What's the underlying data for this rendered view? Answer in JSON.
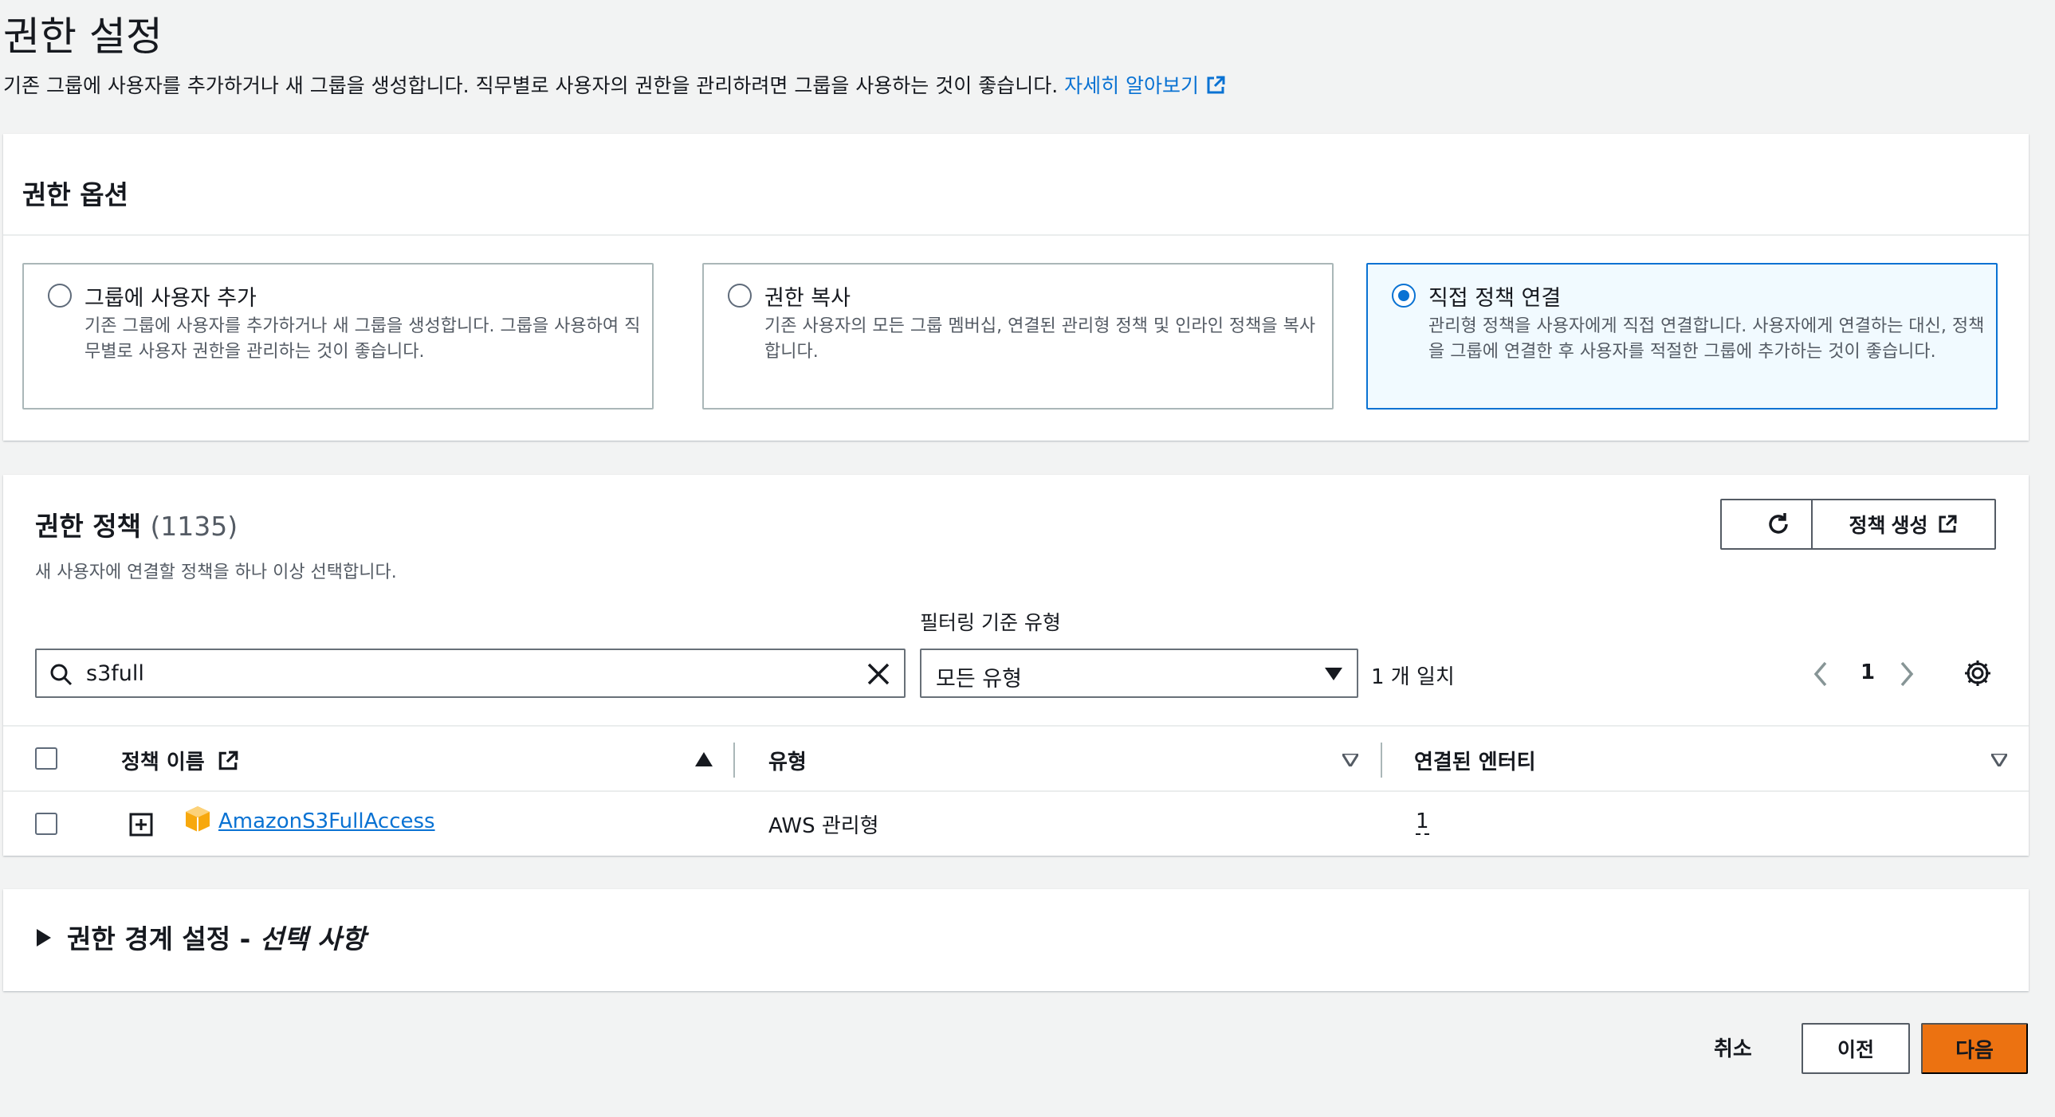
{
  "page": {
    "title": "권한 설정",
    "description": "기존 그룹에 사용자를 추가하거나 새 그룹을 생성합니다. 직무별로 사용자의 권한을 관리하려면 그룹을 사용하는 것이 좋습니다.",
    "learn_more": "자세히 알아보기"
  },
  "permission_options": {
    "title": "권한 옵션",
    "options": [
      {
        "label": "그룹에 사용자 추가",
        "description": "기존 그룹에 사용자를 추가하거나 새 그룹을 생성합니다. 그룹을 사용하여 직무별로 사용자 권한을 관리하는 것이 좋습니다.",
        "selected": false
      },
      {
        "label": "권한 복사",
        "description": "기존 사용자의 모든 그룹 멤버십, 연결된 관리형 정책 및 인라인 정책을 복사합니다.",
        "selected": false
      },
      {
        "label": "직접 정책 연결",
        "description": "관리형 정책을 사용자에게 직접 연결합니다. 사용자에게 연결하는 대신, 정책을 그룹에 연결한 후 사용자를 적절한 그룹에 추가하는 것이 좋습니다.",
        "selected": true
      }
    ]
  },
  "policies": {
    "title": "권한 정책",
    "count": "(1135)",
    "description": "새 사용자에 연결할 정책을 하나 이상 선택합니다.",
    "create_policy_label": "정책 생성",
    "filter_label": "필터링 기준 유형",
    "search_value": "s3full",
    "filter_value": "모든 유형",
    "match_text": "1 개 일치",
    "page_number": "1",
    "columns": {
      "name": "정책 이름",
      "type": "유형",
      "entities": "연결된 엔터티"
    },
    "rows": [
      {
        "name": "AmazonS3FullAccess",
        "type": "AWS 관리형",
        "entities": "1"
      }
    ]
  },
  "boundary": {
    "title": "권한 경계 설정 - ",
    "optional": "선택 사항"
  },
  "footer": {
    "cancel": "취소",
    "previous": "이전",
    "next": "다음"
  },
  "colors": {
    "primary": "#ec7211",
    "link": "#0972d3",
    "selected_bg": "#f1faff"
  }
}
